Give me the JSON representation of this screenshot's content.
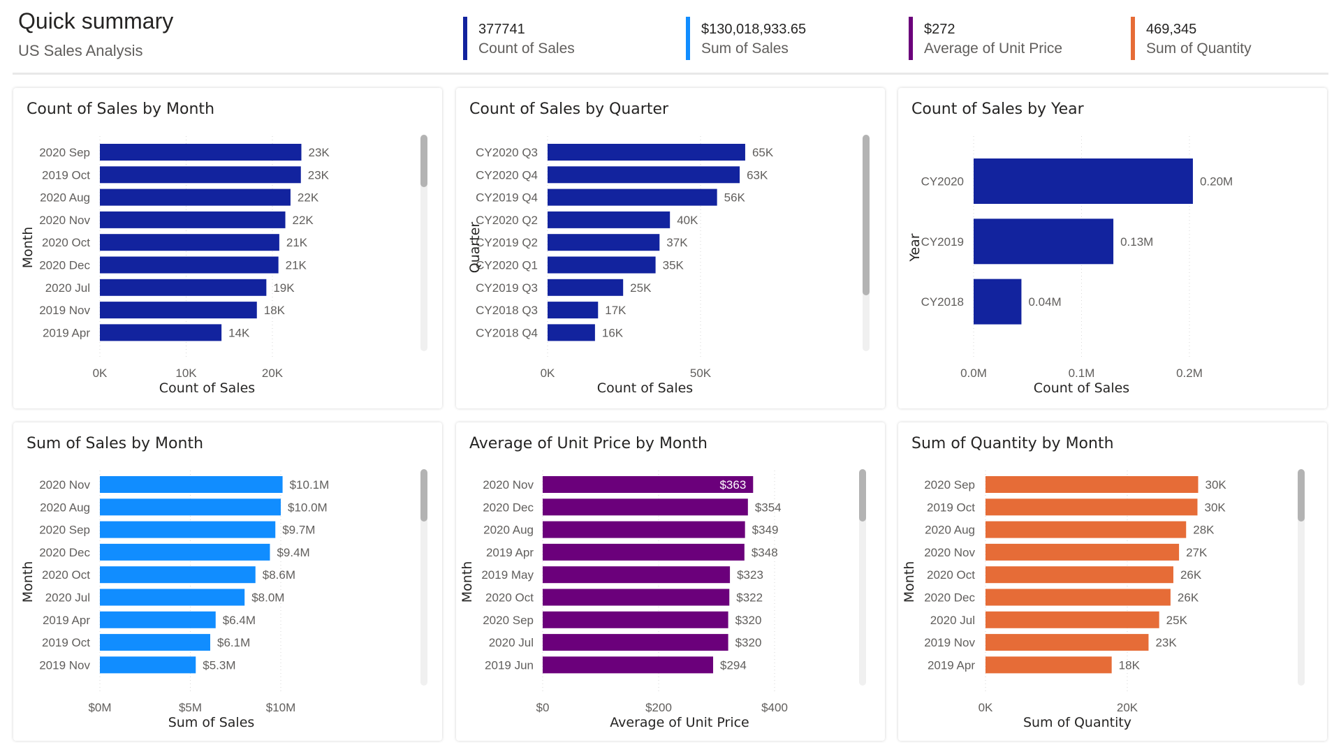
{
  "header": {
    "title": "Quick summary",
    "subtitle": "US Sales Analysis"
  },
  "kpis": [
    {
      "value": "377741",
      "label": "Count of Sales",
      "color": "#12239E"
    },
    {
      "value": "$130,018,933.65",
      "label": "Sum of Sales",
      "color": "#118DFF"
    },
    {
      "value": "$272",
      "label": "Average of Unit Price",
      "color": "#6B007B"
    },
    {
      "value": "469,345",
      "label": "Sum of Quantity",
      "color": "#E66C37"
    }
  ],
  "chart_data": [
    {
      "id": "count-by-month",
      "type": "bar",
      "orientation": "horizontal",
      "title": "Count of Sales by Month",
      "xlabel": "Count of Sales",
      "ylabel": "Month",
      "color": "#12239E",
      "categories": [
        "2020 Sep",
        "2019 Oct",
        "2020 Aug",
        "2020 Nov",
        "2020 Oct",
        "2020 Dec",
        "2020 Jul",
        "2019 Nov",
        "2019 Apr"
      ],
      "values": [
        23360,
        23300,
        22100,
        21500,
        20800,
        20700,
        19300,
        18200,
        14100
      ],
      "labels": [
        "23K",
        "23K",
        "22K",
        "22K",
        "21K",
        "21K",
        "19K",
        "18K",
        "14K"
      ],
      "xlim": [
        0,
        20000
      ],
      "ticks": [
        0,
        10000,
        20000
      ],
      "tick_labels": [
        "0K",
        "10K",
        "20K"
      ],
      "grid": true,
      "scrollable": true,
      "scroll_position": 0
    },
    {
      "id": "count-by-quarter",
      "type": "bar",
      "orientation": "horizontal",
      "title": "Count of Sales by Quarter",
      "xlabel": "Count of Sales",
      "ylabel": "Quarter",
      "color": "#12239E",
      "categories": [
        "CY2020 Q3",
        "CY2020 Q4",
        "CY2019 Q4",
        "CY2020 Q2",
        "CY2019 Q2",
        "CY2020 Q1",
        "CY2019 Q3",
        "CY2018 Q3",
        "CY2018 Q4"
      ],
      "values": [
        64600,
        62800,
        55400,
        40000,
        36600,
        35300,
        24700,
        16500,
        15500
      ],
      "labels": [
        "65K",
        "63K",
        "56K",
        "40K",
        "37K",
        "35K",
        "25K",
        "17K",
        "16K"
      ],
      "xlim": [
        0,
        50000
      ],
      "ticks": [
        0,
        50000
      ],
      "tick_labels": [
        "0K",
        "50K"
      ],
      "grid": true,
      "scrollable": true,
      "scroll_position": 0
    },
    {
      "id": "count-by-year",
      "type": "bar",
      "orientation": "horizontal",
      "title": "Count of Sales by Year",
      "xlabel": "Count of Sales",
      "ylabel": "Year",
      "color": "#12239E",
      "categories": [
        "CY2020",
        "CY2019",
        "CY2018"
      ],
      "values": [
        203200,
        129500,
        44300
      ],
      "labels": [
        "0.20M",
        "0.13M",
        "0.04M"
      ],
      "xlim": [
        0,
        200000
      ],
      "ticks": [
        0,
        100000,
        200000
      ],
      "tick_labels": [
        "0.0M",
        "0.1M",
        "0.2M"
      ],
      "grid": true,
      "scrollable": false
    },
    {
      "id": "sales-by-month",
      "type": "bar",
      "orientation": "horizontal",
      "title": "Sum of Sales by Month",
      "xlabel": "Sum of Sales",
      "ylabel": "Month",
      "color": "#118DFF",
      "categories": [
        "2020 Nov",
        "2020 Aug",
        "2020 Sep",
        "2020 Dec",
        "2020 Oct",
        "2020 Jul",
        "2019 Apr",
        "2019 Oct",
        "2019 Nov"
      ],
      "values": [
        10100000,
        10000000,
        9700000,
        9400000,
        8600000,
        8000000,
        6400000,
        6100000,
        5300000
      ],
      "labels": [
        "$10.1M",
        "$10.0M",
        "$9.7M",
        "$9.4M",
        "$8.6M",
        "$8.0M",
        "$6.4M",
        "$6.1M",
        "$5.3M"
      ],
      "xlim": [
        0,
        10000000
      ],
      "ticks": [
        0,
        5000000,
        10000000
      ],
      "tick_labels": [
        "$0M",
        "$5M",
        "$10M"
      ],
      "grid": true,
      "scrollable": true,
      "scroll_position": 0
    },
    {
      "id": "unit-price-by-month",
      "type": "bar",
      "orientation": "horizontal",
      "title": "Average of Unit Price by Month",
      "xlabel": "Average of Unit Price",
      "ylabel": "Month",
      "color": "#6B007B",
      "categories": [
        "2020 Nov",
        "2020 Dec",
        "2020 Aug",
        "2019 Apr",
        "2019 May",
        "2020 Oct",
        "2020 Sep",
        "2020 Jul",
        "2019 Jun"
      ],
      "values": [
        363,
        354,
        349,
        348,
        323,
        322,
        320,
        320,
        294
      ],
      "labels": [
        "$363",
        "$354",
        "$349",
        "$348",
        "$323",
        "$322",
        "$320",
        "$320",
        "$294"
      ],
      "inside_label_first": true,
      "xlim": [
        0,
        400
      ],
      "ticks": [
        0,
        200,
        400
      ],
      "tick_labels": [
        "$0",
        "$200",
        "$400"
      ],
      "grid": true,
      "scrollable": true,
      "scroll_position": 0
    },
    {
      "id": "quantity-by-month",
      "type": "bar",
      "orientation": "horizontal",
      "title": "Sum of Quantity by Month",
      "xlabel": "Sum of Quantity",
      "ylabel": "Month",
      "color": "#E66C37",
      "categories": [
        "2020 Sep",
        "2019 Oct",
        "2020 Aug",
        "2020 Nov",
        "2020 Oct",
        "2020 Dec",
        "2020 Jul",
        "2019 Nov",
        "2019 Apr"
      ],
      "values": [
        30000,
        29900,
        28300,
        27300,
        26500,
        26100,
        24500,
        23000,
        17800
      ],
      "labels": [
        "30K",
        "30K",
        "28K",
        "27K",
        "26K",
        "26K",
        "25K",
        "23K",
        "18K"
      ],
      "xlim": [
        0,
        20000
      ],
      "ticks": [
        0,
        20000
      ],
      "tick_labels": [
        "0K",
        "20K"
      ],
      "grid": true,
      "scrollable": true,
      "scroll_position": 0
    }
  ]
}
